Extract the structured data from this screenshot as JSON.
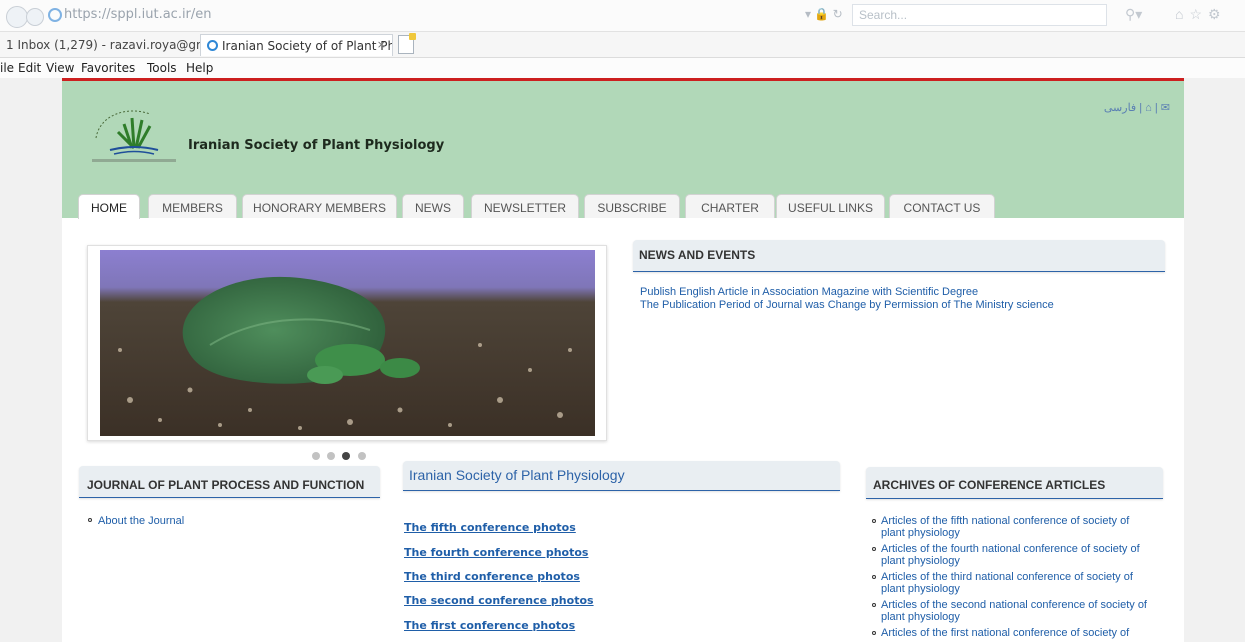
{
  "browser": {
    "url": "https://sppl.iut.ac.ir/en",
    "search_placeholder": "Search...",
    "tabs": [
      {
        "label": "1 Inbox (1,279) - razavi.roya@gm..."
      },
      {
        "label": "Iranian Society of of Plant Ph...",
        "close": "×"
      }
    ],
    "menu": [
      "ile",
      "Edit",
      "View",
      "Favorites",
      "Tools",
      "Help"
    ]
  },
  "site": {
    "title": "Iranian Society of Plant Physiology",
    "lang_links": "فارسی | ⌂ | ✉",
    "nav": [
      "HOME",
      "MEMBERS",
      "HONORARY MEMBERS",
      "NEWS",
      "NEWSLETTER",
      "SUBSCRIBE",
      "CHARTER",
      "USEFUL LINKS",
      "CONTACT US"
    ],
    "active_nav": "HOME"
  },
  "slider": {
    "dots": 4,
    "active_dot": 2
  },
  "news": {
    "heading": "NEWS AND EVENTS",
    "items": [
      "Publish English Article in Association Magazine with Scientific Degree",
      "The Publication Period of Journal was Change by Permission of The Ministry science"
    ]
  },
  "journal": {
    "heading": "JOURNAL OF PLANT PROCESS AND FUNCTION",
    "items": [
      "About the Journal"
    ]
  },
  "society": {
    "heading": "Iranian Society of Plant Physiology",
    "links": [
      "The fifth conference photos",
      "The fourth conference photos",
      "The third conference photos",
      "The second conference photos",
      "The first conference photos"
    ]
  },
  "archives": {
    "heading": "ARCHIVES OF CONFERENCE ARTICLES",
    "items": [
      "Articles of the fifth national conference of society of plant physiology",
      "Articles of the fourth national conference of society of plant physiology",
      "Articles of the third national conference of society of plant physiology",
      "Articles of the second national conference of society of plant physiology",
      "Articles of the first national conference of society of"
    ]
  },
  "colors": {
    "header_green": "#b1d8b8",
    "accent_red": "#cc1f1f",
    "link_blue": "#1f5ea8"
  }
}
